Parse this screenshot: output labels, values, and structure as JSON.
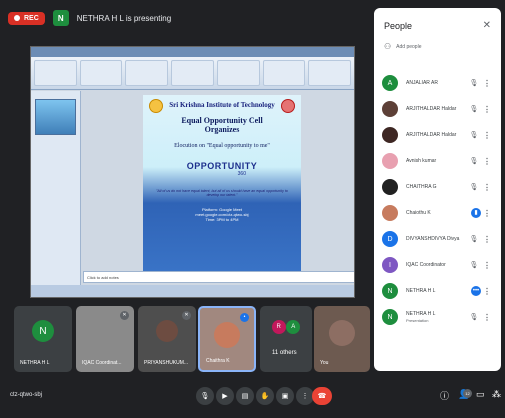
{
  "topbar": {
    "rec_label": "REC",
    "presenter_initial": "N",
    "presenter_text": "NETHRA H L is presenting"
  },
  "slide": {
    "school": "Sri Krishna Institute of Technology",
    "cell": "Equal Opportunity Cell",
    "organizes": "Organizes",
    "topic": "Elocution on \"Equal opportunity to me\"",
    "logo_word": "OPPORTUNITY",
    "logo_num": "360",
    "quote": "\"All of us do not have equal talent, but all of us should have an equal opportunity to develop our talent.\"",
    "platform": "Platform: Google Meet",
    "link": "meet.google.com/ctz-qtwo-sbj",
    "time": "Time: 3PM to 4PM",
    "notes": "Click to add notes"
  },
  "panel": {
    "title": "People",
    "close_icon": "close-icon",
    "add_people_label": "Add people",
    "people": [
      {
        "initial": "A",
        "name": "ANJALIAR AR",
        "role": "",
        "color": "#1e8e3e",
        "mic": "muted"
      },
      {
        "initial": "",
        "name": "ARJITHALDAR Haldar",
        "role": "",
        "color": "#5d4037",
        "mic": "muted"
      },
      {
        "initial": "",
        "name": "ARJITHALDAR Haldar",
        "role": "",
        "color": "#3e2723",
        "mic": "muted"
      },
      {
        "initial": "",
        "name": "Avnish kumar",
        "role": "",
        "color": "#e8a0b0",
        "mic": "muted"
      },
      {
        "initial": "",
        "name": "CHAITHRA G",
        "role": "",
        "color": "#212121",
        "mic": "muted"
      },
      {
        "initial": "",
        "name": "Chaiothu K",
        "role": "",
        "color": "#c77b5e",
        "mic": "active"
      },
      {
        "initial": "D",
        "name": "DIVYANSHDIVYA Divya",
        "role": "",
        "color": "#1a73e8",
        "mic": "muted"
      },
      {
        "initial": "I",
        "name": "IQAC Coordinator",
        "role": "",
        "color": "#7e57c2",
        "mic": "muted"
      },
      {
        "initial": "N",
        "name": "NETHRA H L",
        "role": "",
        "color": "#1e8e3e",
        "mic": "speaking"
      },
      {
        "initial": "N",
        "name": "NETHRA H L",
        "role": "Presentation",
        "color": "#1e8e3e",
        "mic": "present"
      }
    ]
  },
  "tiles": [
    {
      "name": "NETHRA H L",
      "initial": "N",
      "color": "#1e8e3e"
    },
    {
      "name": "IQAC Coordinat...",
      "initial": "",
      "color": "#9e9e9e"
    },
    {
      "name": "PRIYANSHUKUM...",
      "initial": "",
      "color": "#6d4c41"
    },
    {
      "name": "Chaithra K",
      "initial": "",
      "color": "#c77b5e"
    },
    {
      "name": "11 others",
      "initial": "R",
      "color": "#c2185b"
    },
    {
      "name": "You",
      "initial": "",
      "color": "#8d6e63"
    }
  ],
  "bottombar": {
    "meeting_code": "ctz-qtwo-sbj",
    "people_count": "12"
  },
  "colors": {
    "background": "#202124",
    "accent": "#1a73e8",
    "end_call": "#ea4335",
    "rec": "#d93025"
  }
}
